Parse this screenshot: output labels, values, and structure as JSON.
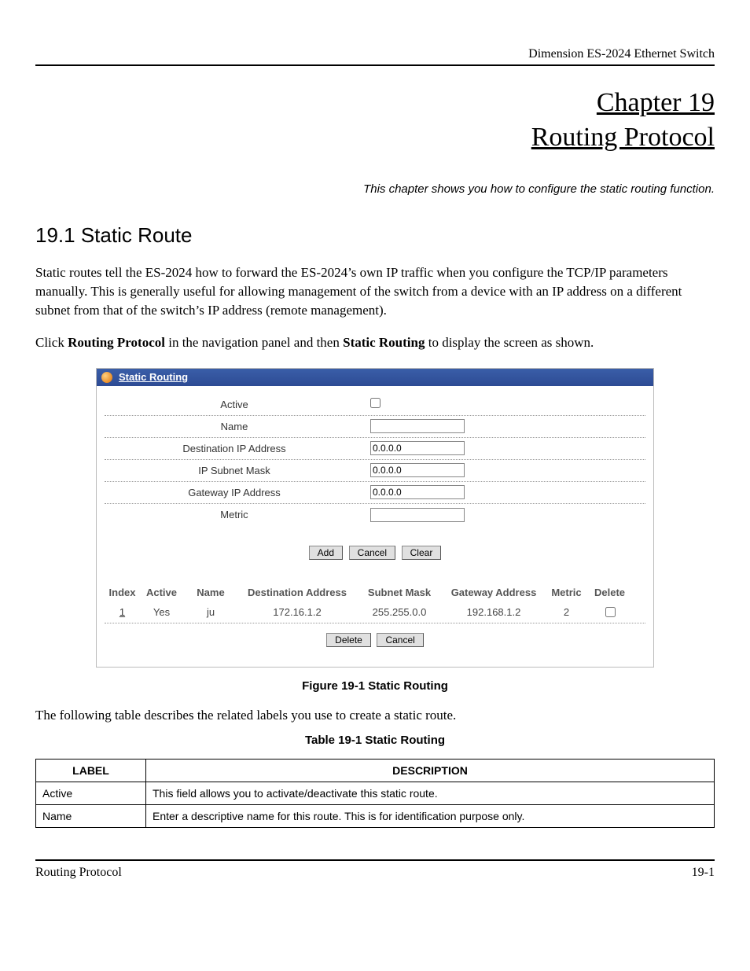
{
  "header": {
    "product": "Dimension ES-2024 Ethernet Switch"
  },
  "chapter": {
    "number": "Chapter 19",
    "name": "Routing Protocol",
    "subtitle": "This chapter shows you how to configure the static routing function."
  },
  "section": {
    "heading": "19.1 Static Route",
    "p1": "Static routes tell the ES-2024 how to forward the ES-2024’s own IP traffic when you configure the TCP/IP parameters manually. This is generally useful for allowing management of the switch from a device with an IP address on a different subnet from that of the switch’s IP address (remote management).",
    "p2_pre": "Click ",
    "p2_b1": "Routing Protocol",
    "p2_mid": " in the navigation panel and then ",
    "p2_b2": "Static Routing",
    "p2_post": " to display the screen as shown."
  },
  "panel": {
    "title": "Static Routing",
    "labels": {
      "active": "Active",
      "name": "Name",
      "dest": "Destination IP Address",
      "mask": "IP Subnet Mask",
      "gateway": "Gateway IP Address",
      "metric": "Metric"
    },
    "values": {
      "name": "",
      "dest": "0.0.0.0",
      "mask": "0.0.0.0",
      "gateway": "0.0.0.0",
      "metric": ""
    },
    "buttons": {
      "add": "Add",
      "cancel": "Cancel",
      "clear": "Clear",
      "delete": "Delete",
      "cancel2": "Cancel"
    },
    "list": {
      "headers": {
        "index": "Index",
        "active": "Active",
        "name": "Name",
        "dest": "Destination Address",
        "mask": "Subnet Mask",
        "gateway": "Gateway Address",
        "metric": "Metric",
        "delete": "Delete"
      },
      "row": {
        "index": "1",
        "active": "Yes",
        "name": "ju",
        "dest": "172.16.1.2",
        "mask": "255.255.0.0",
        "gateway": "192.168.1.2",
        "metric": "2"
      }
    }
  },
  "figure_caption": "Figure 19-1  Static Routing",
  "table_intro": "The following table describes the related labels you use to create a static route.",
  "table_caption": "Table 19-1 Static Routing",
  "desc_table": {
    "head_label": "LABEL",
    "head_desc": "DESCRIPTION",
    "rows": [
      {
        "label": "Active",
        "desc": "This field allows you to activate/deactivate this static route."
      },
      {
        "label": "Name",
        "desc": "Enter a descriptive name for this route. This is for identification purpose only."
      }
    ]
  },
  "footer": {
    "left": "Routing Protocol",
    "right": "19-1"
  }
}
